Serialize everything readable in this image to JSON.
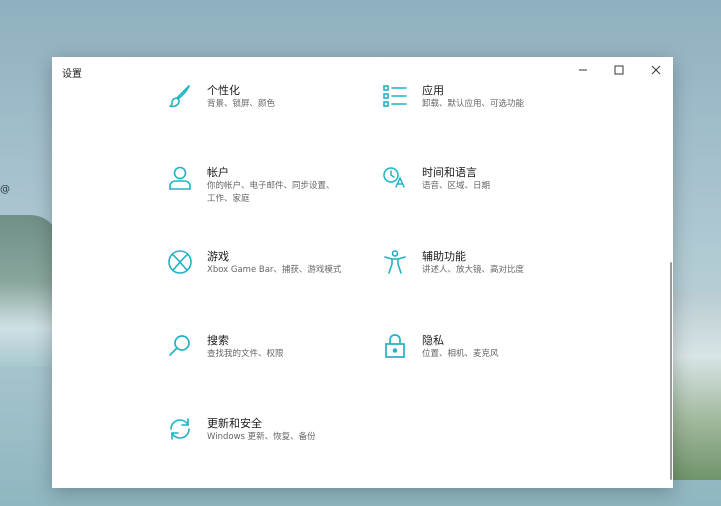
{
  "window": {
    "title": "设置"
  },
  "items": [
    {
      "label": "个性化",
      "desc": "背景、锁屏、颜色",
      "icon": "brush-icon"
    },
    {
      "label": "应用",
      "desc": "卸载、默认应用、可选功能",
      "icon": "apps-list-icon"
    },
    {
      "label": "帐户",
      "desc": "你的帐户、电子邮件、同步设置、工作、家庭",
      "icon": "person-icon"
    },
    {
      "label": "时间和语言",
      "desc": "语音、区域、日期",
      "icon": "time-language-icon"
    },
    {
      "label": "游戏",
      "desc": "Xbox Game Bar、捕获、游戏模式",
      "icon": "xbox-icon"
    },
    {
      "label": "辅助功能",
      "desc": "讲述人、放大镜、高对比度",
      "icon": "accessibility-icon"
    },
    {
      "label": "搜索",
      "desc": "查找我的文件、权限",
      "icon": "search-icon"
    },
    {
      "label": "隐私",
      "desc": "位置、相机、麦克风",
      "icon": "lock-icon"
    },
    {
      "label": "更新和安全",
      "desc": "Windows 更新、恢复、备份",
      "icon": "sync-icon"
    }
  ],
  "colors": {
    "accent": "#1fb3c4"
  }
}
